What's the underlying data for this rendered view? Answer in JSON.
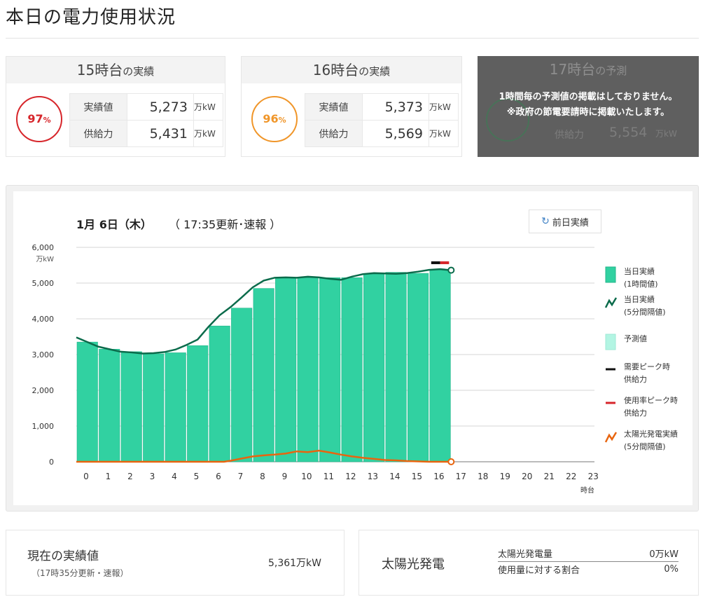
{
  "page": {
    "title": "本日の電力使用状況"
  },
  "hour15": {
    "title_hour": "15時台",
    "title_suffix": "の実績",
    "usage_rate": "97",
    "pct_sign": "%",
    "actual_label": "実績値",
    "actual_value": "5,273",
    "supply_label": "供給力",
    "supply_value": "5,431",
    "unit": "万kW",
    "ring_color": "#d7262b"
  },
  "hour16": {
    "title_hour": "16時台",
    "title_suffix": "の実績",
    "usage_rate": "96",
    "pct_sign": "%",
    "actual_label": "実績値",
    "actual_value": "5,373",
    "supply_label": "供給力",
    "supply_value": "5,569",
    "unit": "万kW",
    "ring_color": "#f0962a"
  },
  "hour17": {
    "title_hour": "17時台",
    "title_suffix": "の予測",
    "notice_line1": "1時間毎の予測値の掲載はしておりません。",
    "notice_line2": "※政府の節電要請時に掲載いたします。",
    "supply_label": "供給力",
    "supply_value": "5,554",
    "unit": "万kW"
  },
  "chart_header": {
    "date": "1月 6日（木）",
    "update": "（ 17:35更新･速報 ）",
    "prev_day_button": "前日実績",
    "refresh_icon": "refresh-icon"
  },
  "chart_data": {
    "type": "bar",
    "x_categories": [
      "0",
      "1",
      "2",
      "3",
      "4",
      "5",
      "6",
      "7",
      "8",
      "9",
      "10",
      "11",
      "12",
      "13",
      "14",
      "15",
      "16",
      "17",
      "18",
      "19",
      "20",
      "21",
      "22",
      "23"
    ],
    "x_axis_unit": "時台",
    "y_axis_unit": "万kW",
    "ylim": [
      0,
      6000
    ],
    "y_ticks": [
      "0",
      "1,000",
      "2,000",
      "3,000",
      "4,000",
      "5,000",
      "6,000"
    ],
    "grid": true,
    "series": [
      {
        "name": "当日実績\n(1時間値)",
        "kind": "bar",
        "color": "#31d1a1",
        "values": [
          3350,
          3150,
          3080,
          3020,
          3050,
          3250,
          3800,
          4300,
          4850,
          5150,
          5150,
          5150,
          5150,
          5250,
          5300,
          5273,
          5373
        ]
      },
      {
        "name": "当日実績\n(5分間隔値)",
        "kind": "line",
        "color": "#0b6b4b",
        "x": [
          0,
          0.5,
          1,
          1.5,
          2,
          2.5,
          3,
          3.5,
          4,
          4.5,
          5,
          5.5,
          6,
          6.5,
          7,
          7.5,
          8,
          8.5,
          9,
          9.5,
          10,
          10.5,
          11,
          11.5,
          12,
          12.5,
          13,
          13.5,
          14,
          14.5,
          15,
          15.5,
          16,
          16.5,
          17
        ],
        "values": [
          3480,
          3350,
          3220,
          3150,
          3080,
          3060,
          3030,
          3040,
          3070,
          3140,
          3270,
          3420,
          3780,
          4100,
          4330,
          4600,
          4880,
          5070,
          5150,
          5160,
          5150,
          5180,
          5160,
          5120,
          5090,
          5180,
          5250,
          5280,
          5270,
          5260,
          5280,
          5320,
          5370,
          5390,
          5361
        ]
      },
      {
        "name": "予測値",
        "kind": "bar",
        "color": "#b3f5e3",
        "values": []
      },
      {
        "name": "需要ピーク時\n供給力",
        "kind": "marker",
        "color": "#111111",
        "x": 16,
        "value": 5569
      },
      {
        "name": "使用率ピーク時\n供給力",
        "kind": "marker",
        "color": "#d7262b",
        "x": 16,
        "value": 5569
      },
      {
        "name": "太陽光発電実績\n(5分間隔値)",
        "kind": "line",
        "color": "#e8650f",
        "x": [
          0,
          1,
          2,
          3,
          4,
          5,
          6,
          6.7,
          7,
          7.5,
          8,
          8.5,
          9,
          9.5,
          10,
          10.5,
          11,
          11.5,
          12,
          12.5,
          13,
          13.5,
          14,
          14.5,
          15,
          15.5,
          16,
          16.5,
          17
        ],
        "values": [
          0,
          0,
          0,
          0,
          0,
          0,
          0,
          0,
          30,
          90,
          150,
          180,
          200,
          230,
          290,
          270,
          310,
          260,
          200,
          150,
          110,
          80,
          50,
          40,
          20,
          10,
          0,
          0,
          0
        ]
      }
    ]
  },
  "current": {
    "title": "現在の実績値",
    "subtitle": "（17時35分更新・速報）",
    "value": "5,361万kW"
  },
  "solar": {
    "title": "太陽光発電",
    "gen_label": "太陽光発電量",
    "gen_value": "0万kW",
    "ratio_label": "使用量に対する割合",
    "ratio_value": "0%"
  }
}
